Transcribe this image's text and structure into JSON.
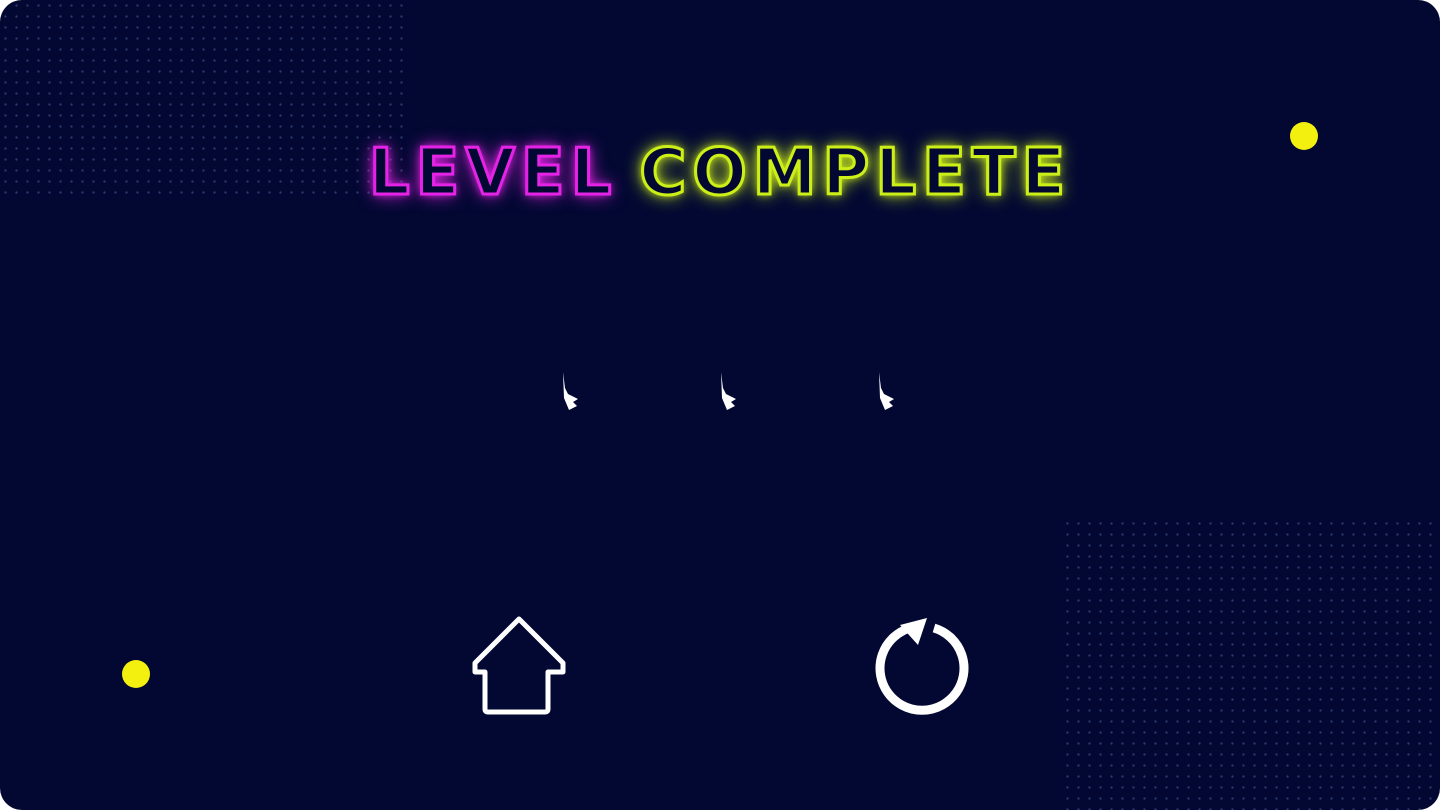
{
  "title": {
    "word1": "LEVEL",
    "word2": "COMPLETE"
  },
  "colors": {
    "background": "#020832",
    "title_word1": "#e523e6",
    "title_word2": "#ccef18",
    "accent_dot": "#f3f010",
    "icon_stroke": "#ffffff"
  },
  "stars": {
    "earned": 3,
    "total": 3
  },
  "buttons": {
    "home_icon": "home-icon",
    "replay_icon": "replay-icon"
  }
}
